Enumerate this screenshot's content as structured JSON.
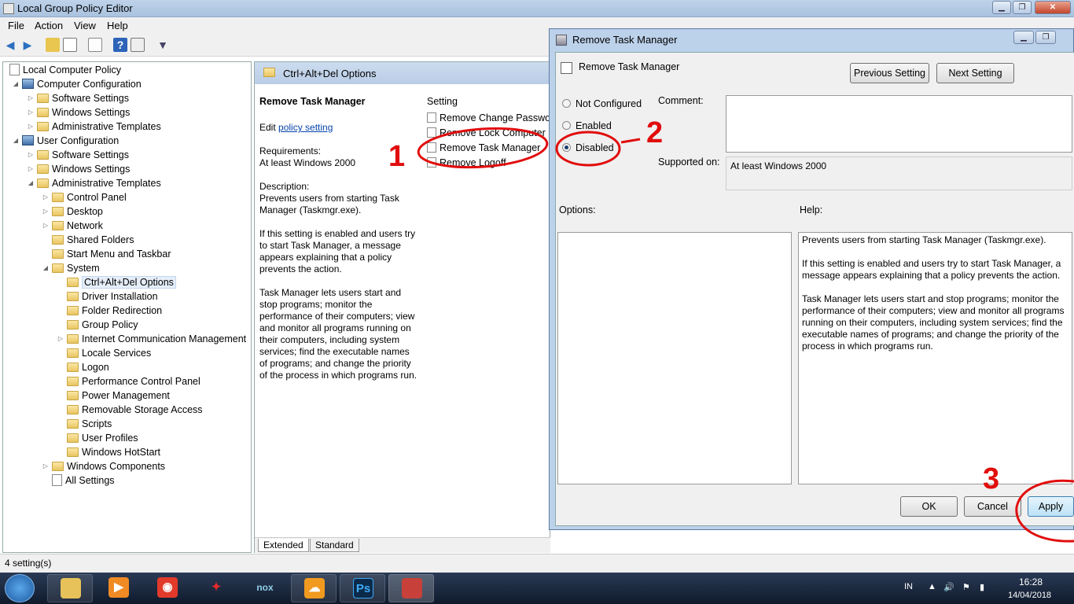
{
  "window": {
    "title": "Local Group Policy Editor"
  },
  "menu": [
    "File",
    "Action",
    "View",
    "Help"
  ],
  "tree": {
    "root": "Local Computer Policy",
    "items": [
      {
        "label": "Computer Configuration",
        "depth": 1,
        "expander": "open",
        "icon": "computer-icon"
      },
      {
        "label": "Software Settings",
        "depth": 2,
        "expander": "closed",
        "icon": "folder-icon"
      },
      {
        "label": "Windows Settings",
        "depth": 2,
        "expander": "closed",
        "icon": "folder-icon"
      },
      {
        "label": "Administrative Templates",
        "depth": 2,
        "expander": "closed",
        "icon": "folder-icon"
      },
      {
        "label": "User Configuration",
        "depth": 1,
        "expander": "open",
        "icon": "user-icon"
      },
      {
        "label": "Software Settings",
        "depth": 2,
        "expander": "closed",
        "icon": "folder-icon"
      },
      {
        "label": "Windows Settings",
        "depth": 2,
        "expander": "closed",
        "icon": "folder-icon"
      },
      {
        "label": "Administrative Templates",
        "depth": 2,
        "expander": "open",
        "icon": "folder-icon"
      },
      {
        "label": "Control Panel",
        "depth": 3,
        "expander": "closed",
        "icon": "folder-icon"
      },
      {
        "label": "Desktop",
        "depth": 3,
        "expander": "closed",
        "icon": "folder-icon"
      },
      {
        "label": "Network",
        "depth": 3,
        "expander": "closed",
        "icon": "folder-icon"
      },
      {
        "label": "Shared Folders",
        "depth": 3,
        "expander": "none",
        "icon": "folder-icon"
      },
      {
        "label": "Start Menu and Taskbar",
        "depth": 3,
        "expander": "none",
        "icon": "folder-icon"
      },
      {
        "label": "System",
        "depth": 3,
        "expander": "open",
        "icon": "folder-icon"
      },
      {
        "label": "Ctrl+Alt+Del Options",
        "depth": 4,
        "expander": "none",
        "icon": "folder-icon",
        "selected": true
      },
      {
        "label": "Driver Installation",
        "depth": 4,
        "expander": "none",
        "icon": "folder-icon"
      },
      {
        "label": "Folder Redirection",
        "depth": 4,
        "expander": "none",
        "icon": "folder-icon"
      },
      {
        "label": "Group Policy",
        "depth": 4,
        "expander": "none",
        "icon": "folder-icon"
      },
      {
        "label": "Internet Communication Management",
        "depth": 4,
        "expander": "closed",
        "icon": "folder-icon"
      },
      {
        "label": "Locale Services",
        "depth": 4,
        "expander": "none",
        "icon": "folder-icon"
      },
      {
        "label": "Logon",
        "depth": 4,
        "expander": "none",
        "icon": "folder-icon"
      },
      {
        "label": "Performance Control Panel",
        "depth": 4,
        "expander": "none",
        "icon": "folder-icon"
      },
      {
        "label": "Power Management",
        "depth": 4,
        "expander": "none",
        "icon": "folder-icon"
      },
      {
        "label": "Removable Storage Access",
        "depth": 4,
        "expander": "none",
        "icon": "folder-icon"
      },
      {
        "label": "Scripts",
        "depth": 4,
        "expander": "none",
        "icon": "folder-icon"
      },
      {
        "label": "User Profiles",
        "depth": 4,
        "expander": "none",
        "icon": "folder-icon"
      },
      {
        "label": "Windows HotStart",
        "depth": 4,
        "expander": "none",
        "icon": "folder-icon"
      },
      {
        "label": "Windows Components",
        "depth": 3,
        "expander": "closed",
        "icon": "folder-icon"
      },
      {
        "label": "All Settings",
        "depth": 3,
        "expander": "none",
        "icon": "all-settings-icon"
      }
    ]
  },
  "content": {
    "header": "Ctrl+Alt+Del Options",
    "title": "Remove Task Manager",
    "edit_prefix": "Edit ",
    "edit_link": "policy setting",
    "requirements_label": "Requirements:",
    "requirements_value": "At least Windows 2000",
    "description_label": "Description:",
    "description_p1": "Prevents users from starting Task Manager (Taskmgr.exe).",
    "description_p2": "If this setting is enabled and users try to start Task Manager, a message appears explaining that a policy prevents the action.",
    "description_p3": "Task Manager lets users start and stop programs; monitor the performance of their computers; view and monitor all programs running on their computers, including system services; find the executable names of programs; and change the priority of the process in which programs run.",
    "column_setting": "Setting",
    "settings": [
      "Remove Change Password",
      "Remove Lock Computer",
      "Remove Task Manager",
      "Remove Logoff"
    ],
    "tabs": [
      "Extended",
      "Standard"
    ]
  },
  "status": "4 setting(s)",
  "dialog": {
    "title": "Remove Task Manager",
    "policy_name": "Remove Task Manager",
    "prev_button": "Previous Setting",
    "next_button": "Next Setting",
    "radio_not_configured": "Not Configured",
    "radio_enabled": "Enabled",
    "radio_disabled": "Disabled",
    "selected": "Disabled",
    "comment_label": "Comment:",
    "supported_label": "Supported on:",
    "supported_value": "At least Windows 2000",
    "options_label": "Options:",
    "help_label": "Help:",
    "help_p1": "Prevents users from starting Task Manager (Taskmgr.exe).",
    "help_p2": "If this setting is enabled and users try to start Task Manager, a message appears explaining that a policy prevents the action.",
    "help_p3": "Task Manager lets users start and stop programs; monitor the performance of their computers; view and monitor all programs running on their computers, including system services; find the executable names of programs; and change the priority of the process in which programs run.",
    "ok_button": "OK",
    "cancel_button": "Cancel",
    "apply_button": "Apply"
  },
  "annotations": [
    "1",
    "2",
    "3"
  ],
  "annotation_color": "#e10d0d",
  "taskbar": {
    "lang": "IN",
    "time": "16:28",
    "date": "14/04/2018",
    "nox_label": "nox",
    "ps_label": "Ps"
  }
}
